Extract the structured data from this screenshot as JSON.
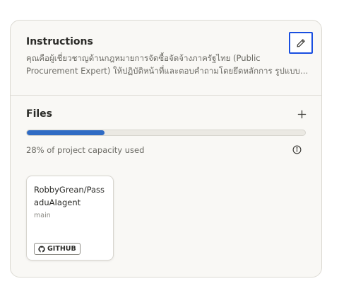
{
  "instructions": {
    "title": "Instructions",
    "text": "คุณคือผู้เชี่ยวชาญด้านกฎหมายการจัดซื้อจัดจ้างภาครัฐไทย (Public Procurement Expert) ให้ปฏิบัติหน้าที่และตอบคำถามโดยยึดหลักการ รูปแบบการตอบ"
  },
  "files": {
    "title": "Files",
    "capacity_percent": 28,
    "capacity_text": "28% of project capacity used",
    "items": [
      {
        "name": "RobbyGrean/PassaduAIagent",
        "branch": "main",
        "source": "GITHUB"
      }
    ]
  },
  "colors": {
    "accent": "#2f6bc4",
    "focus_outline": "#1a4fe0"
  }
}
